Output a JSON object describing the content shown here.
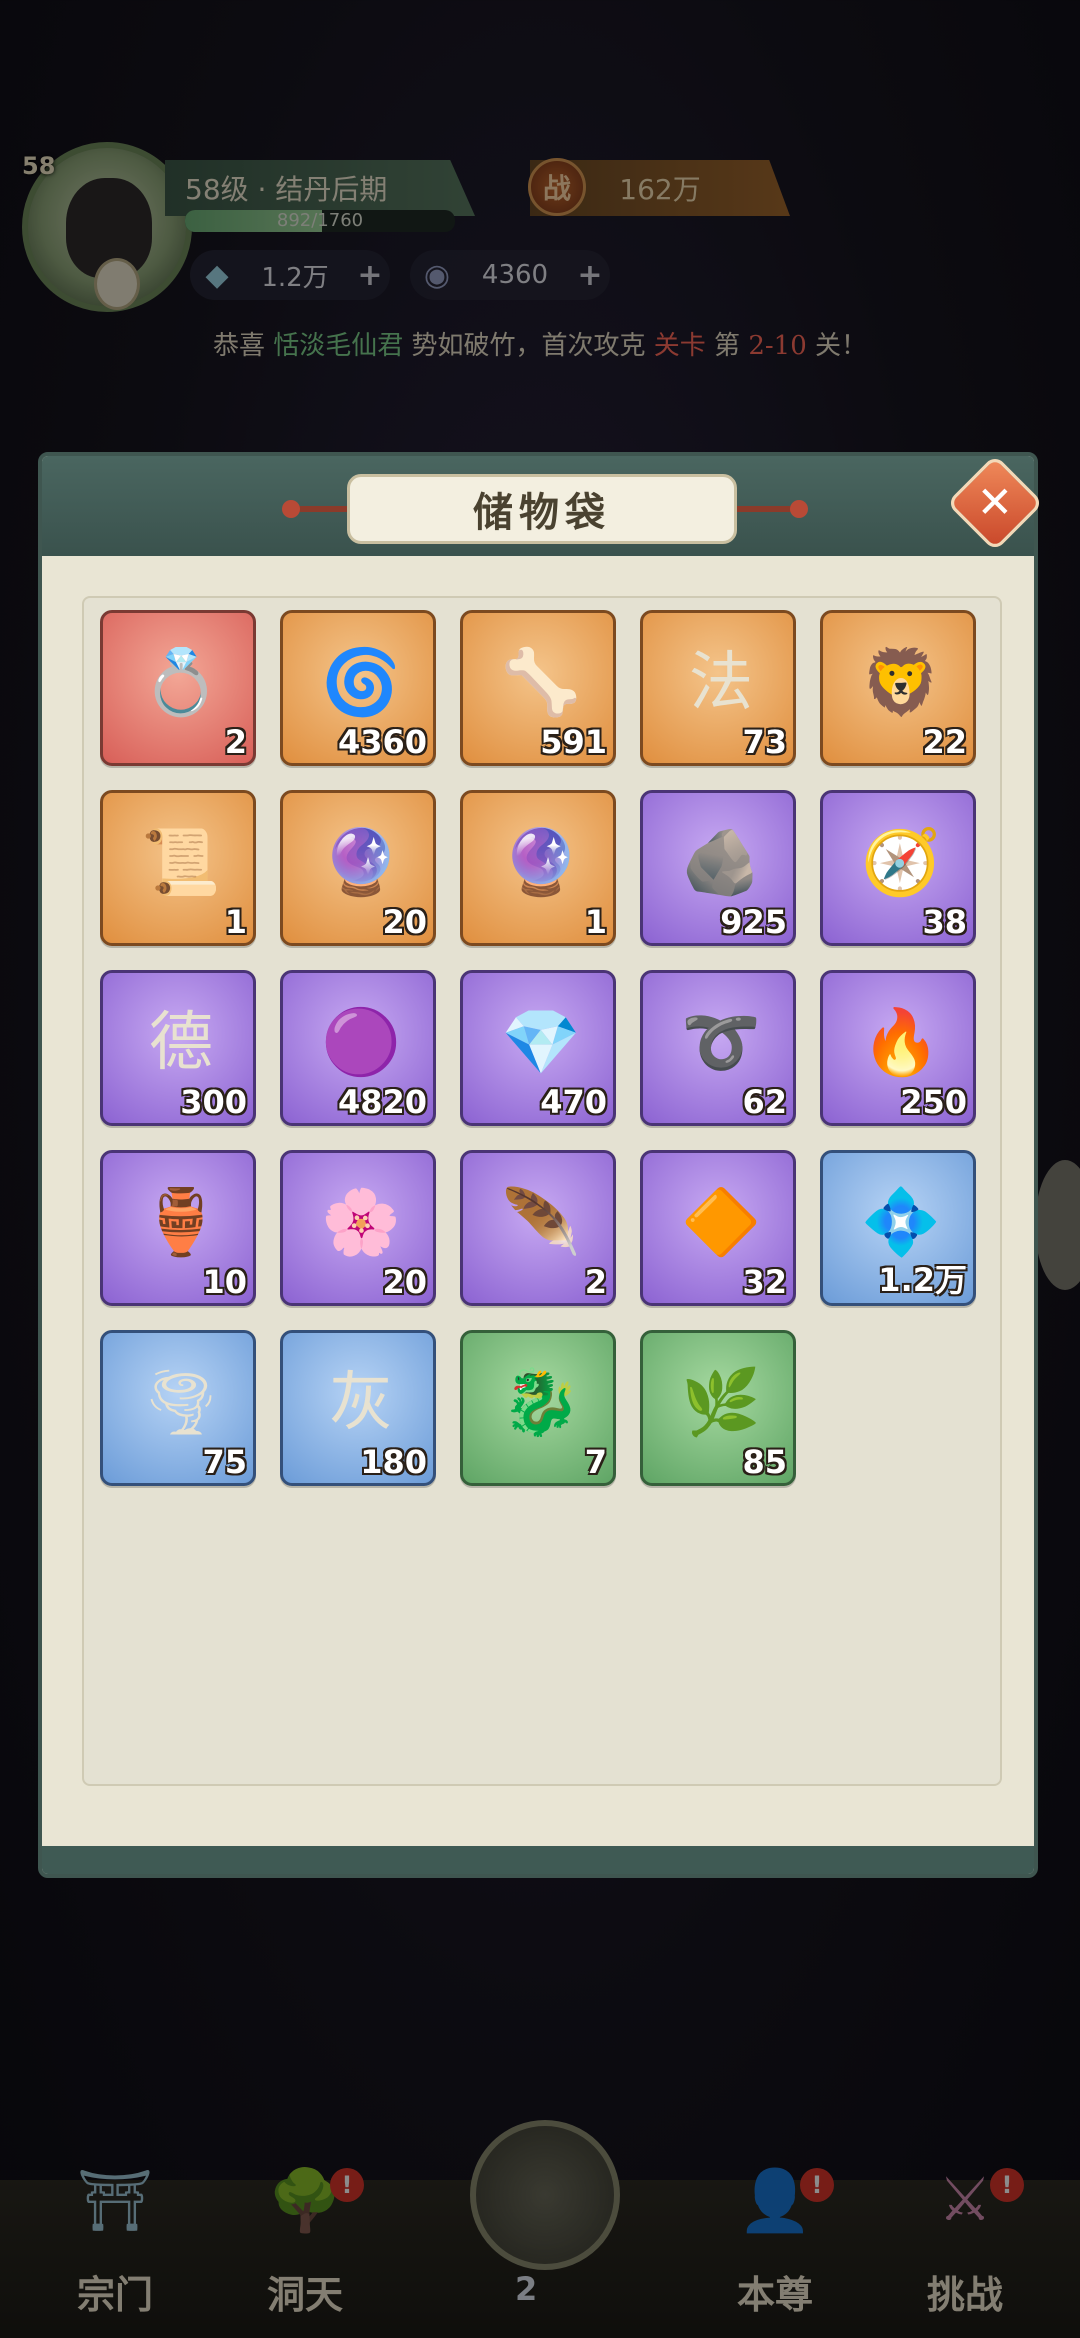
{
  "header": {
    "level_badge": "58",
    "rank_text": "58级 · 结丹后期",
    "exp_text": "892/1760",
    "exp_progress": 0.507,
    "power_icon": "战",
    "power_value": "162万",
    "currencies": [
      {
        "icon": "crystal-icon",
        "amount": "1.2万",
        "plus": "+"
      },
      {
        "icon": "spirit-coin-icon",
        "amount": "4360",
        "plus": "+"
      }
    ],
    "announcement": {
      "prefix": "恭喜 ",
      "name": "恬淡毛仙君",
      "mid": " 势如破竹，首次攻克 ",
      "stage": "关卡",
      "pre_num": " 第 ",
      "num": "2-10",
      "suffix": " 关！"
    }
  },
  "panel": {
    "title": "储物袋",
    "close_icon": "✕",
    "items": [
      {
        "name": "golden-ring",
        "glyph": "💍",
        "count": "2",
        "rarity": "red"
      },
      {
        "name": "blue-orb",
        "glyph": "🌀",
        "count": "4360",
        "rarity": "orange"
      },
      {
        "name": "white-claw",
        "glyph": "🦴",
        "count": "591",
        "rarity": "orange"
      },
      {
        "name": "law-token",
        "glyph": "法",
        "count": "73",
        "rarity": "orange"
      },
      {
        "name": "jade-lion",
        "glyph": "🦁",
        "count": "22",
        "rarity": "orange"
      },
      {
        "name": "talisman-paper",
        "glyph": "📜",
        "count": "1",
        "rarity": "orange"
      },
      {
        "name": "orb-scroll",
        "glyph": "🔮",
        "count": "20",
        "rarity": "orange"
      },
      {
        "name": "crystal-ball-stand",
        "glyph": "🔮",
        "count": "1",
        "rarity": "orange"
      },
      {
        "name": "dark-ore",
        "glyph": "🪨",
        "count": "925",
        "rarity": "purple"
      },
      {
        "name": "compass",
        "glyph": "🧭",
        "count": "38",
        "rarity": "purple"
      },
      {
        "name": "virtue-gourd",
        "glyph": "德",
        "count": "300",
        "rarity": "purple"
      },
      {
        "name": "purple-pearl",
        "glyph": "🟣",
        "count": "4820",
        "rarity": "purple"
      },
      {
        "name": "gold-crystal",
        "glyph": "💎",
        "count": "470",
        "rarity": "purple"
      },
      {
        "name": "dark-ring",
        "glyph": "➰",
        "count": "62",
        "rarity": "purple"
      },
      {
        "name": "flame-core",
        "glyph": "🔥",
        "count": "250",
        "rarity": "purple"
      },
      {
        "name": "jade-vase",
        "glyph": "🏺",
        "count": "10",
        "rarity": "purple"
      },
      {
        "name": "pink-flower-orb",
        "glyph": "🌸",
        "count": "20",
        "rarity": "purple"
      },
      {
        "name": "storm-feather",
        "glyph": "🪶",
        "count": "2",
        "rarity": "purple"
      },
      {
        "name": "amber-crystal",
        "glyph": "🔶",
        "count": "32",
        "rarity": "purple"
      },
      {
        "name": "ice-crystal",
        "glyph": "💠",
        "count": "1.2万",
        "rarity": "blue"
      },
      {
        "name": "wind-orb",
        "glyph": "🌪",
        "count": "75",
        "rarity": "blue"
      },
      {
        "name": "fire-scroll",
        "glyph": "灰",
        "count": "180",
        "rarity": "blue"
      },
      {
        "name": "dragon-pearl",
        "glyph": "🐉",
        "count": "7",
        "rarity": "green"
      },
      {
        "name": "herb-leaf",
        "glyph": "🌿",
        "count": "85",
        "rarity": "green"
      }
    ]
  },
  "nav": {
    "items": [
      {
        "label": "宗门",
        "icon": "sect-gate-icon",
        "badge": ""
      },
      {
        "label": "洞天",
        "icon": "cave-tree-icon",
        "badge": "!"
      },
      {
        "label": "本尊",
        "icon": "character-icon",
        "badge": "!"
      },
      {
        "label": "挑战",
        "icon": "challenge-swords-icon",
        "badge": "!"
      }
    ],
    "center_count": "2"
  }
}
